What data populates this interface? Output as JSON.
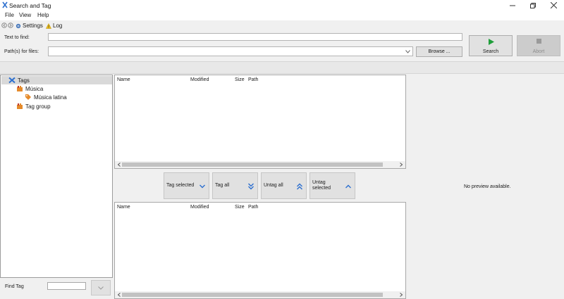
{
  "window": {
    "title": "Search and Tag"
  },
  "menu": {
    "file": "File",
    "view": "View",
    "help": "Help"
  },
  "toolbar": {
    "settings": "Settings",
    "log": "Log"
  },
  "search": {
    "text_label": "Text to find:",
    "text_value": "",
    "path_label": "Path(s) for files:",
    "path_value": "",
    "browse_label": "Browse ...",
    "search_label": "Search",
    "abort_label": "Abort"
  },
  "tree": {
    "root": "Tags",
    "items": [
      "Música",
      "Música latina",
      "Tag group"
    ]
  },
  "find_tag": {
    "label": "Find Tag",
    "value": ""
  },
  "file_list": {
    "columns": [
      "Name",
      "Modified",
      "Size",
      "Path"
    ]
  },
  "tag_buttons": {
    "tag_selected": "Tag selected",
    "tag_all": "Tag all",
    "untag_all": "Untag all",
    "untag_selected": "Untag selected"
  },
  "preview": {
    "message": "No preview available."
  },
  "colors": {
    "accent": "#2c6fcf",
    "tag_orange": "#e58a2a",
    "search_green": "#1f9e3a"
  }
}
